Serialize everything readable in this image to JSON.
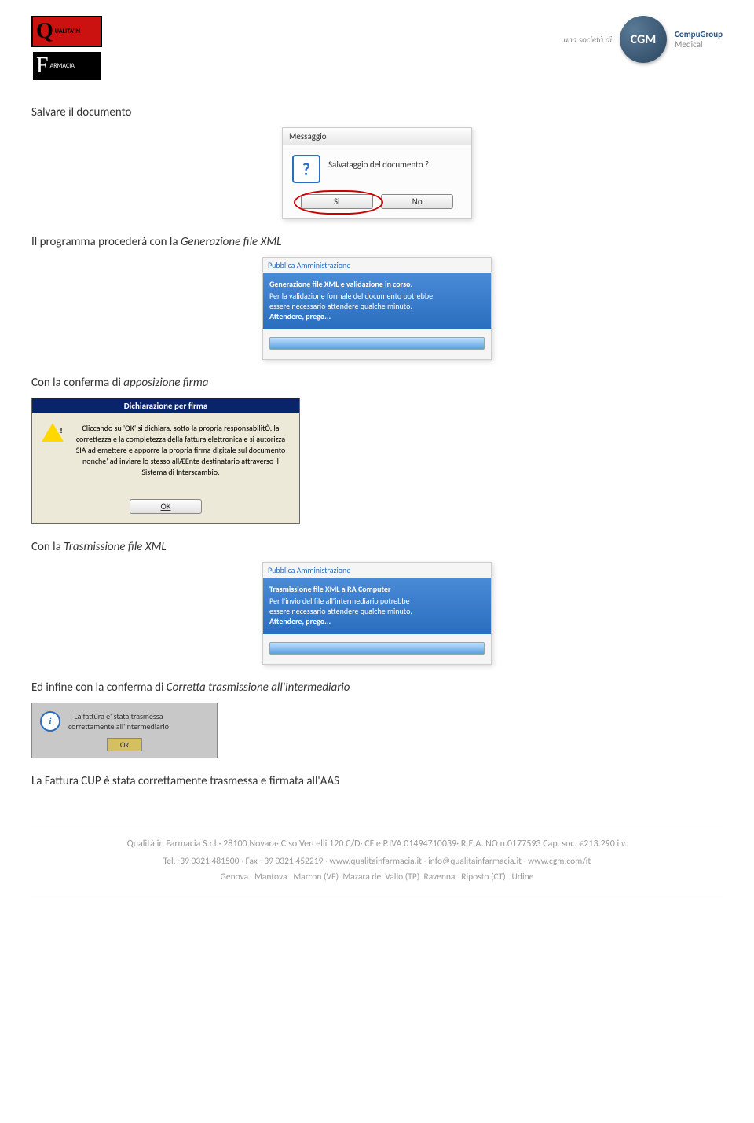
{
  "header": {
    "logo_left": {
      "q_label": "UALITA'IN",
      "f_label": "ARMACIA"
    },
    "societa": "una società di",
    "cgm": {
      "badge": "CGM",
      "line1": "CompuGroup",
      "line2": "Medical"
    }
  },
  "p1": {
    "pre": "Salvare il documento"
  },
  "dlg1": {
    "title": "Messaggio",
    "question": "Salvataggio del documento ?",
    "yes": "Si",
    "no": "No"
  },
  "p2": {
    "pre": "Il programma procederà con la ",
    "italic": "Generazione file XML"
  },
  "dlg2": {
    "title": "Pubblica Amministrazione",
    "bold": "Generazione file XML e validazione in corso.",
    "line2": "Per la validazione formale del documento potrebbe",
    "line3": "essere necessario attendere qualche minuto.",
    "line4": "Attendere, prego..."
  },
  "p3": {
    "pre": "Con la conferma di ",
    "italic": "apposizione firma"
  },
  "dlg3": {
    "title": "Dichiarazione per firma",
    "text": "Cliccando su 'OK' si dichiara, sotto la propria responsabilitÓ, la correttezza e la completezza della fattura elettronica e si autorizza SIA ad emettere e apporre la propria firma digitale sul documento nonche' ad inviare lo stesso allÆEnte destinatario attraverso il Sistema di Interscambio.",
    "ok": "OK"
  },
  "p4": {
    "pre": "Con la ",
    "italic": "Trasmissione file XML"
  },
  "dlg4": {
    "title": "Pubblica Amministrazione",
    "bold": "Trasmissione file XML a RA Computer",
    "line2": "Per l'invio del file all'intermediario potrebbe",
    "line3": "essere necessario attendere qualche minuto.",
    "line4": "Attendere, prego..."
  },
  "p5": {
    "pre": "Ed infine con la conferma di ",
    "italic": "Corretta trasmissione all'intermediario"
  },
  "dlg5": {
    "line1": "La fattura e' stata trasmessa",
    "line2": "correttamente all'intermediario",
    "ok": "Ok"
  },
  "p6": "La Fattura CUP è stata correttamente trasmessa e firmata all'AAS",
  "footer": {
    "l1": "Qualità in Farmacia S.r.l.· 28100 Novara· C.so Vercelli 120 C/D· CF e P.IVA 01494710039· R.E.A. NO n.0177593 Cap. soc. €213.290 i.v.",
    "l2": "Tel.+39 0321 481500 · Fax +39 0321 452219 · www.qualitainfarmacia.it · info@qualitainfarmacia.it · www.cgm.com/it",
    "l3": "Genova   Mantova   Marcon (VE)  Mazara del Vallo (TP)  Ravenna   Riposto (CT)   Udine"
  }
}
